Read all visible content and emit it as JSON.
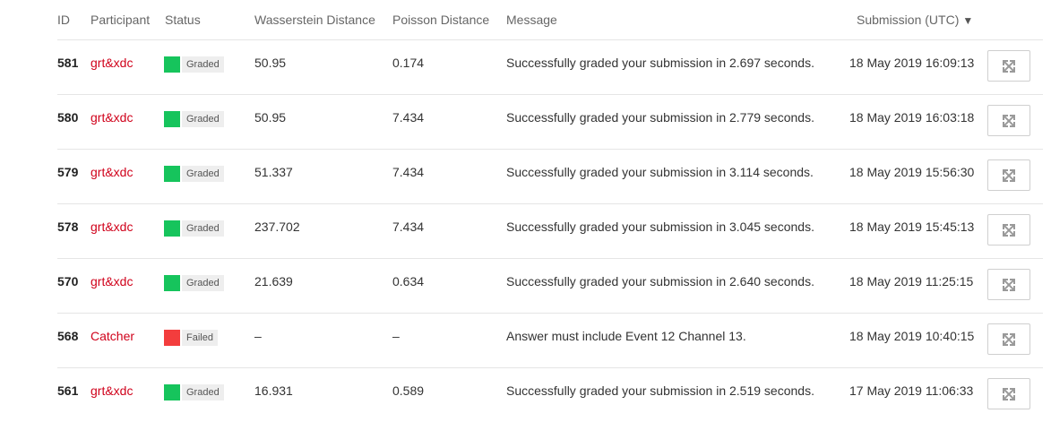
{
  "headers": {
    "id": "ID",
    "participant": "Participant",
    "status": "Status",
    "wasserstein": "Wasserstein Distance",
    "poisson": "Poisson Distance",
    "message": "Message",
    "submission": "Submission (UTC)",
    "sort_indicator": "▼"
  },
  "colors": {
    "graded": "#16c45c",
    "failed": "#f33d3d",
    "participant_link": "#d0021b"
  },
  "icons": {
    "expand": "expand-arrows-icon"
  },
  "rows": [
    {
      "id": "581",
      "participant": "grt&xdc",
      "status": "Graded",
      "status_type": "graded",
      "wasserstein": "50.95",
      "poisson": "0.174",
      "message": "Successfully graded your submission in 2.697 seconds.",
      "submitted": "18 May 2019 16:09:13"
    },
    {
      "id": "580",
      "participant": "grt&xdc",
      "status": "Graded",
      "status_type": "graded",
      "wasserstein": "50.95",
      "poisson": "7.434",
      "message": "Successfully graded your submission in 2.779 seconds.",
      "submitted": "18 May 2019 16:03:18"
    },
    {
      "id": "579",
      "participant": "grt&xdc",
      "status": "Graded",
      "status_type": "graded",
      "wasserstein": "51.337",
      "poisson": "7.434",
      "message": "Successfully graded your submission in 3.114 seconds.",
      "submitted": "18 May 2019 15:56:30"
    },
    {
      "id": "578",
      "participant": "grt&xdc",
      "status": "Graded",
      "status_type": "graded",
      "wasserstein": "237.702",
      "poisson": "7.434",
      "message": "Successfully graded your submission in 3.045 seconds.",
      "submitted": "18 May 2019 15:45:13"
    },
    {
      "id": "570",
      "participant": "grt&xdc",
      "status": "Graded",
      "status_type": "graded",
      "wasserstein": "21.639",
      "poisson": "0.634",
      "message": "Successfully graded your submission in 2.640 seconds.",
      "submitted": "18 May 2019 11:25:15"
    },
    {
      "id": "568",
      "participant": "Catcher",
      "status": "Failed",
      "status_type": "failed",
      "wasserstein": "–",
      "poisson": "–",
      "message": "Answer must include Event 12 Channel 13.",
      "submitted": "18 May 2019 10:40:15"
    },
    {
      "id": "561",
      "participant": "grt&xdc",
      "status": "Graded",
      "status_type": "graded",
      "wasserstein": "16.931",
      "poisson": "0.589",
      "message": "Successfully graded your submission in 2.519 seconds.",
      "submitted": "17 May 2019 11:06:33"
    }
  ]
}
